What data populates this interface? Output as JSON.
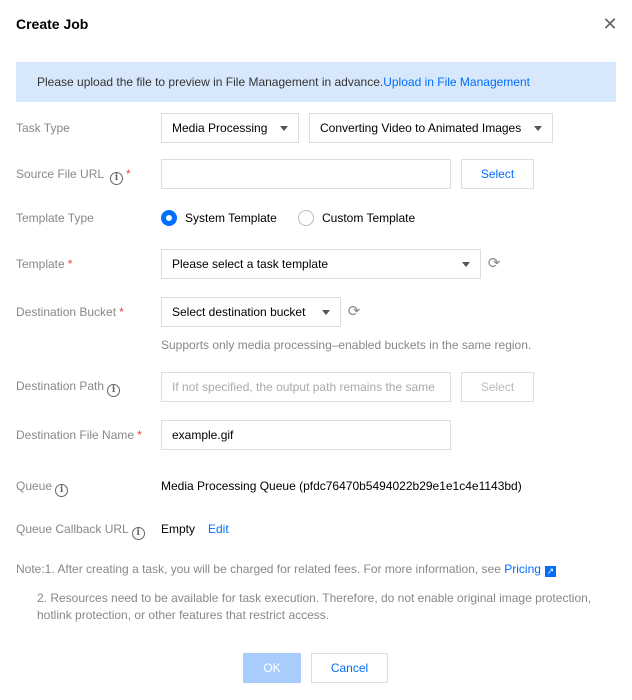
{
  "dialog": {
    "title": "Create Job",
    "close_icon": "close-icon"
  },
  "banner": {
    "text": "Please upload the file to preview in File Management in advance.",
    "link": "Upload in File Management"
  },
  "task_type": {
    "label": "Task Type",
    "primary": "Media Processing",
    "secondary": "Converting Video to Animated Images"
  },
  "source_url": {
    "label": "Source File URL",
    "value": "",
    "button": "Select"
  },
  "template_type": {
    "label": "Template Type",
    "options": [
      "System Template",
      "Custom Template"
    ],
    "selected": "System Template"
  },
  "template": {
    "label": "Template",
    "placeholder": "Please select a task template"
  },
  "dest_bucket": {
    "label": "Destination Bucket",
    "placeholder": "Select destination bucket",
    "hint": "Supports only media processing–enabled buckets in the same region."
  },
  "dest_path": {
    "label": "Destination Path",
    "placeholder": "If not specified, the output path remains the same",
    "button": "Select"
  },
  "dest_file": {
    "label": "Destination File Name",
    "value": "example.gif"
  },
  "queue": {
    "label": "Queue",
    "value": "Media Processing Queue (pfdc76470b5494022b29e1e1c4e1143bd)"
  },
  "callback": {
    "label": "Queue Callback URL",
    "value": "Empty",
    "edit": "Edit"
  },
  "notes": {
    "line1": "Note:1. After creating a task, you will be charged for related fees. For more information, see ",
    "pricing": "Pricing",
    "line2a": "2. Resources need to be available for task execution. Therefore, do not enable original image protection,",
    "line2b": "hotlink protection, or other features that restrict access."
  },
  "footer": {
    "ok": "OK",
    "cancel": "Cancel"
  },
  "required_mark": "*",
  "colors": {
    "accent": "#006eff",
    "banner": "#d8e8fc",
    "required": "#e54545"
  }
}
